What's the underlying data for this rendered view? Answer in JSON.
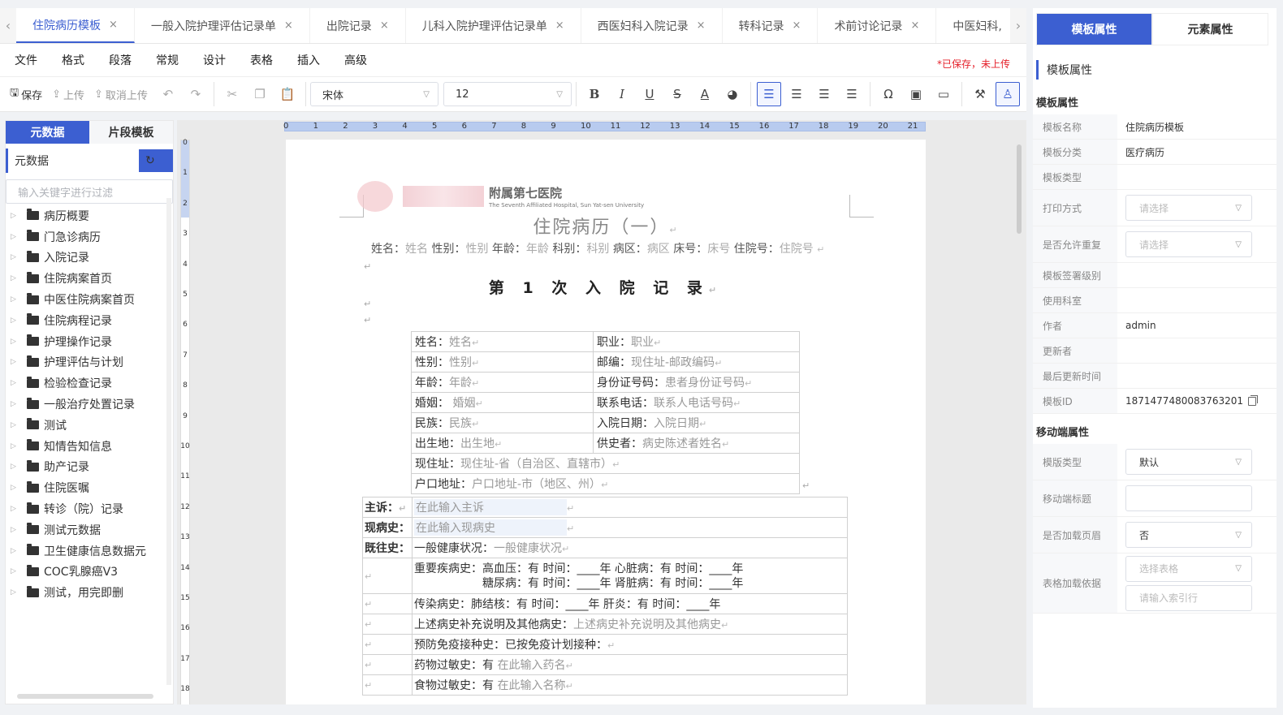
{
  "tabs": [
    {
      "label": "住院病历模板",
      "active": true
    },
    {
      "label": "一般入院护理评估记录单"
    },
    {
      "label": "出院记录"
    },
    {
      "label": "儿科入院护理评估记录单"
    },
    {
      "label": "西医妇科入院记录"
    },
    {
      "label": "转科记录"
    },
    {
      "label": "术前讨论记录"
    },
    {
      "label": "中医妇科,"
    }
  ],
  "menu": [
    "文件",
    "格式",
    "段落",
    "常规",
    "设计",
    "表格",
    "插入",
    "高级"
  ],
  "save_status": "*已保存，未上传",
  "toolbar": {
    "save": "保存",
    "upload": "上传",
    "cancel_upload": "取消上传",
    "font": "宋体",
    "size": "12"
  },
  "left": {
    "tab_meta": "元数据",
    "tab_snippet": "片段模板",
    "header": "元数据",
    "search_placeholder": "输入关键字进行过滤",
    "tree": [
      "病历概要",
      "门急诊病历",
      "入院记录",
      "住院病案首页",
      "中医住院病案首页",
      "住院病程记录",
      "护理操作记录",
      "护理评估与计划",
      "检验检查记录",
      "一般治疗处置记录",
      "测试",
      "知情告知信息",
      "助产记录",
      "住院医嘱",
      "转诊（院）记录",
      "测试元数据",
      "卫生健康信息数据元",
      "COC乳腺癌V3",
      "测试，用完即删"
    ]
  },
  "ruler": {
    "h": [
      "0",
      "1",
      "2",
      "3",
      "4",
      "5",
      "6",
      "7",
      "8",
      "9",
      "10",
      "11",
      "12",
      "13",
      "14",
      "15",
      "16",
      "17",
      "18",
      "19",
      "20",
      "21"
    ],
    "v": [
      "0",
      "1",
      "2",
      "3",
      "4",
      "5",
      "6",
      "7",
      "8",
      "9",
      "10",
      "11",
      "12",
      "13",
      "14",
      "15",
      "16",
      "17",
      "18"
    ]
  },
  "doc": {
    "hospital_cn": "附属第七医院",
    "hospital_en": "The Seventh Affiliated Hospital, Sun Yat-sen University",
    "title": "住院病历（一）",
    "patient_line": [
      {
        "k": "姓名：",
        "v": "姓名"
      },
      {
        "k": "性别：",
        "v": "性别"
      },
      {
        "k": "年龄：",
        "v": "年龄"
      },
      {
        "k": "科别：",
        "v": "科别"
      },
      {
        "k": "病区：",
        "v": "病区"
      },
      {
        "k": "床号：",
        "v": "床号"
      },
      {
        "k": "住院号：",
        "v": "住院号"
      }
    ],
    "admit_title": "第 1 次 入 院 记 录",
    "info_table": [
      [
        {
          "k": "姓名：",
          "v": "姓名"
        },
        {
          "k": "职业：",
          "v": "职业"
        }
      ],
      [
        {
          "k": "性别：",
          "v": "性别"
        },
        {
          "k": "邮编：",
          "v": "现住址-邮政编码"
        }
      ],
      [
        {
          "k": "年龄：",
          "v": "年龄"
        },
        {
          "k": "身份证号码：",
          "v": "患者身份证号码"
        }
      ],
      [
        {
          "k": "婚姻：",
          "v": " 婚姻"
        },
        {
          "k": "联系电话：",
          "v": "联系人电话号码"
        }
      ],
      [
        {
          "k": "民族：",
          "v": "民族"
        },
        {
          "k": "入院日期：",
          "v": "入院日期"
        }
      ],
      [
        {
          "k": "出生地：",
          "v": "出生地"
        },
        {
          "k": "供史者：",
          "v": "病史陈述者姓名"
        }
      ]
    ],
    "info_wide": [
      {
        "k": "现住址：",
        "v": "现住址-省（自治区、直辖市）"
      },
      {
        "k": "户口地址：",
        "v": "户口地址-市（地区、州）"
      }
    ],
    "chief": {
      "k": "主诉：",
      "v": "在此输入主诉"
    },
    "present": {
      "k": "现病史：",
      "v": "在此输入现病史"
    },
    "past": {
      "k": "既往史：",
      "v_k": "一般健康状况：",
      "v": "一般健康状况"
    },
    "major_1": "重要疾病史：高血压：有 时间：____年   心脏病：有 时间：____年",
    "major_2": "糖尿病：有 时间：____年   肾脏病：有 时间：____年",
    "infect": "传染病史：肺结核：有 时间：____年   肝炎：有 时间：____年",
    "other": {
      "k": "上述病史补充说明及其他病史：",
      "v": "上述病史补充说明及其他病史"
    },
    "vaccine": "预防免疫接种史：已按免疫计划接种：",
    "drug_allergy": {
      "k": "药物过敏史：有 ",
      "v": "在此输入药名"
    },
    "food_allergy": {
      "k": "食物过敏史：有 ",
      "v": "在此输入名称"
    }
  },
  "right": {
    "tab_template": "模板属性",
    "tab_element": "元素属性",
    "head": "模板属性",
    "section_template": "模板属性",
    "props": [
      {
        "label": "模板名称",
        "value": "住院病历模板"
      },
      {
        "label": "模板分类",
        "value": "医疗病历"
      },
      {
        "label": "模板类型",
        "value": ""
      }
    ],
    "print_mode": {
      "label": "打印方式",
      "placeholder": "请选择"
    },
    "allow_repeat": {
      "label": "是否允许重复",
      "placeholder": "请选择"
    },
    "props2": [
      {
        "label": "模板签署级别",
        "value": ""
      },
      {
        "label": "使用科室",
        "value": ""
      },
      {
        "label": "作者",
        "value": "admin"
      },
      {
        "label": "更新者",
        "value": ""
      },
      {
        "label": "最后更新时间",
        "value": ""
      }
    ],
    "template_id": {
      "label": "模板ID",
      "value": "1871477480083763201"
    },
    "section_mobile": "移动端属性",
    "mobile_type": {
      "label": "模版类型",
      "value": "默认"
    },
    "mobile_title": {
      "label": "移动端标题",
      "value": ""
    },
    "load_header": {
      "label": "是否加载页眉",
      "value": "否"
    },
    "table_basis": {
      "label": "表格加载依据",
      "select_placeholder": "选择表格",
      "input_placeholder": "请输入索引行"
    }
  }
}
